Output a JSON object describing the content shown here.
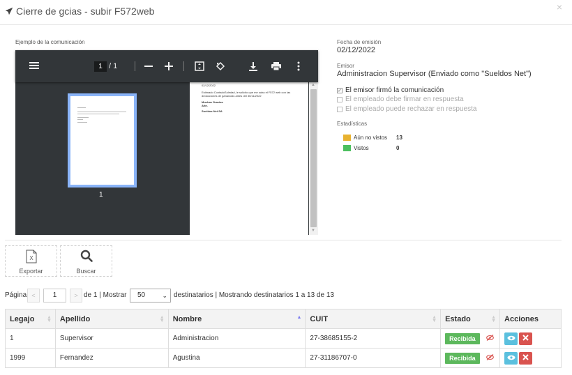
{
  "modal": {
    "title": "Cierre de gcias - subir F572web",
    "close": "×"
  },
  "preview": {
    "label": "Ejemplo de la comunicación",
    "current_page": "1",
    "total_pages": "/ 1",
    "thumb_page_number": "1",
    "doc_lines": [
      "02/12/2022",
      "Estimado ContadoSoledad, le solicito que me suba el F572 web con las",
      "deducciones de ganancias antes del 30/11/2022",
      "Muchas Gracias",
      "Atte.",
      "Sueldos Net SA"
    ]
  },
  "info": {
    "fecha_label": "Fecha de emisión",
    "fecha_value": "02/12/2022",
    "emisor_label": "Emisor",
    "emisor_value": "Administracion Supervisor (Enviado como \"Sueldos Net\")",
    "checks": [
      {
        "label": "El emisor firmó la comunicación",
        "checked": true,
        "disabled": false
      },
      {
        "label": "El empleado debe firmar en respuesta",
        "checked": false,
        "disabled": true
      },
      {
        "label": "El empleado puede rechazar en respuesta",
        "checked": false,
        "disabled": true
      }
    ],
    "stats_label": "Estadísticas",
    "stats": [
      {
        "label": "Aún no vistos",
        "count": "13",
        "color": "#e8b230"
      },
      {
        "label": "Vistos",
        "count": "0",
        "color": "#4cbf5f"
      }
    ]
  },
  "actions": {
    "export_label": "Exportar",
    "search_label": "Buscar"
  },
  "pager": {
    "page_label": "Página",
    "prev": "<",
    "next": ">",
    "page_value": "1",
    "of_text": "de 1 | Mostrar",
    "page_size": "50",
    "summary": "destinatarios | Mostrando destinatarios 1 a 13 de 13"
  },
  "table": {
    "headers": [
      "Legajo",
      "Apellido",
      "Nombre",
      "CUIT",
      "Estado",
      "Acciones"
    ],
    "rows": [
      {
        "legajo": "1",
        "apellido": "Supervisor",
        "nombre": "Administracion",
        "cuit": "27-38685155-2",
        "estado": "Recibida"
      },
      {
        "legajo": "1999",
        "apellido": "Fernandez",
        "nombre": "Agustina",
        "cuit": "27-31186707-0",
        "estado": "Recibida"
      }
    ]
  },
  "colors": {
    "badge_green": "#5cb85c",
    "btn_view": "#5bc0de",
    "btn_delete": "#d9534f"
  }
}
